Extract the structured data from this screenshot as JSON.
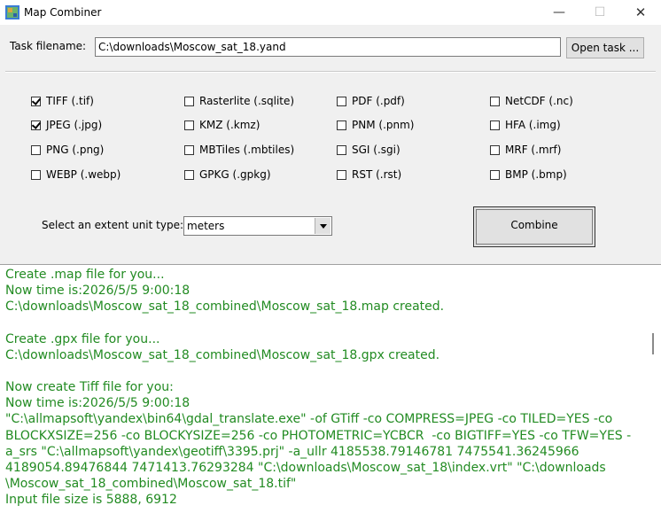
{
  "window": {
    "title": "Map Combiner",
    "app_icon": "map-combiner-app-icon"
  },
  "task": {
    "label": "Task filename:",
    "value": "C:\\downloads\\Moscow_sat_18.yand",
    "open_button": "Open task ..."
  },
  "formats": [
    {
      "label": "TIFF (.tif)",
      "checked": true
    },
    {
      "label": "Rasterlite (.sqlite)",
      "checked": false
    },
    {
      "label": "PDF (.pdf)",
      "checked": false
    },
    {
      "label": "NetCDF (.nc)",
      "checked": false
    },
    {
      "label": "JPEG (.jpg)",
      "checked": true
    },
    {
      "label": "KMZ (.kmz)",
      "checked": false
    },
    {
      "label": "PNM (.pnm)",
      "checked": false
    },
    {
      "label": "HFA (.img)",
      "checked": false
    },
    {
      "label": "PNG (.png)",
      "checked": false
    },
    {
      "label": "MBTiles (.mbtiles)",
      "checked": false
    },
    {
      "label": "SGI (.sgi)",
      "checked": false
    },
    {
      "label": "MRF (.mrf)",
      "checked": false
    },
    {
      "label": "WEBP (.webp)",
      "checked": false
    },
    {
      "label": "GPKG (.gpkg)",
      "checked": false
    },
    {
      "label": "RST (.rst)",
      "checked": false
    },
    {
      "label": "BMP (.bmp)",
      "checked": false
    }
  ],
  "extent": {
    "label": "Select an extent unit type:",
    "value": "meters"
  },
  "combine_button": "Combine",
  "log": {
    "color": "#228b22",
    "lines": [
      "Create .map file for you...",
      "Now time is:2026/5/5 9:00:18",
      "C:\\downloads\\Moscow_sat_18_combined\\Moscow_sat_18.map created.",
      "",
      "Create .gpx file for you...",
      "C:\\downloads\\Moscow_sat_18_combined\\Moscow_sat_18.gpx created.",
      "",
      "Now create Tiff file for you:",
      "Now time is:2026/5/5 9:00:18",
      "\"C:\\allmapsoft\\yandex\\bin64\\gdal_translate.exe\" -of GTiff -co COMPRESS=JPEG -co TILED=YES -co",
      "BLOCKXSIZE=256 -co BLOCKYSIZE=256 -co PHOTOMETRIC=YCBCR  -co BIGTIFF=YES -co TFW=YES -",
      "a_srs \"C:\\allmapsoft\\yandex\\geotiff\\3395.prj\" -a_ullr 4185538.79146781 7475541.36245966",
      "4189054.89476844 7471413.76293284 \"C:\\downloads\\Moscow_sat_18\\index.vrt\" \"C:\\downloads",
      "\\Moscow_sat_18_combined\\Moscow_sat_18.tif\"",
      "Input file size is 5888, 6912"
    ]
  }
}
